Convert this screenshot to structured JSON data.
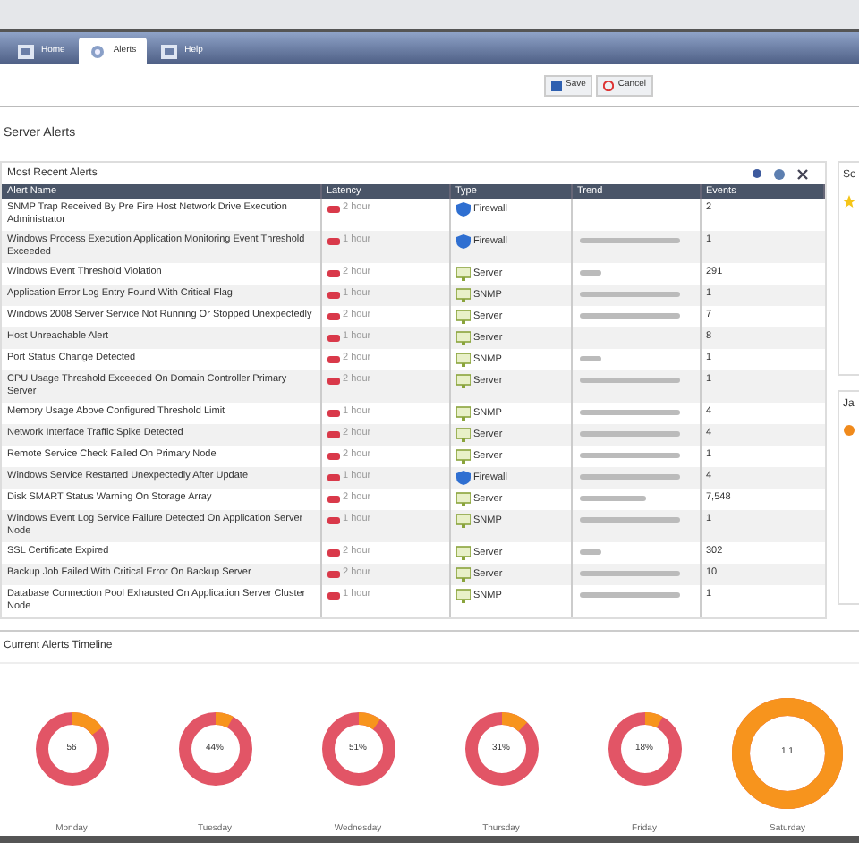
{
  "tabs": [
    {
      "label": "Home",
      "kind": "grid",
      "selected": false
    },
    {
      "label": "Alerts",
      "kind": "gear",
      "selected": true
    },
    {
      "label": "Help",
      "kind": "grid",
      "selected": false
    }
  ],
  "toolbar": {
    "buttons": [
      {
        "label": "Save",
        "kind": "save"
      },
      {
        "label": "Cancel",
        "kind": "cancel"
      }
    ]
  },
  "page_title": "Server Alerts",
  "alerts_panel": {
    "title": "Most Recent Alerts",
    "columns": [
      "Alert Name",
      "Latency",
      "Type",
      "Trend",
      "Events"
    ],
    "rows": [
      {
        "name": "SNMP Trap Received By Pre Fire Host Network Drive Execution Administrator",
        "latency": "2 hour",
        "type": "Firewall",
        "kind": "shield",
        "count": "2"
      },
      {
        "name": "Windows Process Execution Application Monitoring Event Threshold Exceeded",
        "latency": "1 hour",
        "type": "Firewall",
        "kind": "shield",
        "level": 0.9,
        "count": "1"
      },
      {
        "name": "Windows Event Threshold Violation",
        "latency": "2 hour",
        "type": "Server",
        "kind": "monitor",
        "level": 0.2,
        "count": "291"
      },
      {
        "name": "Application Error Log Entry Found With Critical Flag",
        "latency": "1 hour",
        "type": "SNMP",
        "kind": "monitor",
        "level": 0.9,
        "count": "1"
      },
      {
        "name": "Windows 2008 Server Service Not Running Or Stopped Unexpectedly",
        "latency": "2 hour",
        "type": "Server",
        "kind": "monitor",
        "level": 0.9,
        "count": "7"
      },
      {
        "name": "Host Unreachable Alert",
        "latency": "1 hour",
        "type": "Server",
        "kind": "monitor",
        "count": "8"
      },
      {
        "name": "Port Status Change Detected",
        "latency": "2 hour",
        "type": "SNMP",
        "kind": "monitor",
        "level": 0.2,
        "count": "1"
      },
      {
        "name": "CPU Usage Threshold Exceeded On Domain Controller Primary Server",
        "latency": "2 hour",
        "type": "Server",
        "kind": "monitor",
        "level": 0.9,
        "count": "1"
      },
      {
        "name": "Memory Usage Above Configured Threshold Limit",
        "latency": "1 hour",
        "type": "SNMP",
        "kind": "monitor",
        "level": 0.9,
        "count": "4"
      },
      {
        "name": "Network Interface Traffic Spike Detected",
        "latency": "2 hour",
        "type": "Server",
        "kind": "monitor",
        "level": 0.9,
        "count": "4"
      },
      {
        "name": "Remote Service Check Failed On Primary Node",
        "latency": "2 hour",
        "type": "Server",
        "kind": "monitor",
        "level": 0.9,
        "count": "1"
      },
      {
        "name": "Windows Service Restarted Unexpectedly After Update",
        "latency": "1 hour",
        "type": "Firewall",
        "kind": "shield",
        "level": 0.9,
        "count": "4"
      },
      {
        "name": "Disk SMART Status Warning On Storage Array",
        "latency": "2 hour",
        "type": "Server",
        "kind": "monitor",
        "level": 0.6,
        "count": "7,548"
      },
      {
        "name": "Windows Event Log Service Failure Detected On Application Server Node",
        "latency": "1 hour",
        "type": "SNMP",
        "kind": "monitor",
        "level": 0.9,
        "count": "1"
      },
      {
        "name": "SSL Certificate Expired",
        "latency": "2 hour",
        "type": "Server",
        "kind": "monitor",
        "level": 0.2,
        "count": "302"
      },
      {
        "name": "Backup Job Failed With Critical Error On Backup Server",
        "latency": "2 hour",
        "type": "Server",
        "kind": "monitor",
        "level": 0.9,
        "count": "10"
      },
      {
        "name": "Database Connection Pool Exhausted On Application Server Cluster Node",
        "latency": "1 hour",
        "type": "SNMP",
        "kind": "monitor",
        "level": 0.9,
        "count": "1"
      }
    ]
  },
  "side_panels": [
    {
      "title": "Se",
      "kind": "star"
    },
    {
      "title": "Ja",
      "kind": "dot"
    }
  ],
  "timeline": {
    "title": "Current Alerts Timeline",
    "days": [
      {
        "center": "56",
        "label": "Monday",
        "level": 0.15
      },
      {
        "center": "44%",
        "label": "Tuesday",
        "level": 0.08
      },
      {
        "center": "51%",
        "label": "Wednesday",
        "level": 0.1
      },
      {
        "center": "31%",
        "label": "Thursday",
        "level": 0.12
      },
      {
        "center": "18%",
        "label": "Friday",
        "level": 0.08
      },
      {
        "center": "1.1",
        "label": "Saturday",
        "level": 1,
        "kind": "large"
      }
    ]
  }
}
